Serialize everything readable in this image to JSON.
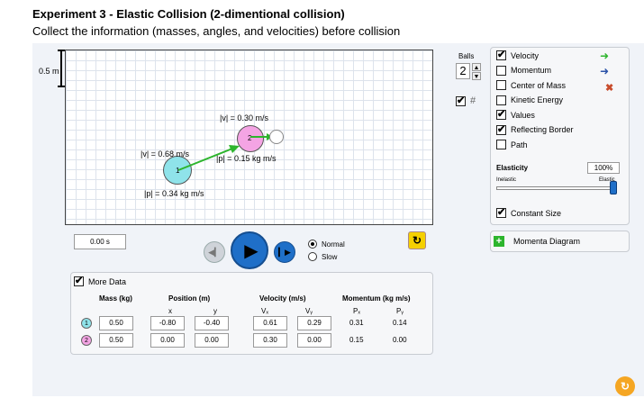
{
  "heading": "Experiment 3 - Elastic Collision (2-dimentional collision)",
  "subheading": "Collect the information (masses, angles, and velocities) before collision",
  "scale": "0.5 m",
  "field_labels": {
    "v2": "|v| = 0.30 m/s",
    "v1": "|v| = 0.68 m/s",
    "p2": "|p| = 0.15 kg m/s",
    "p1": "|p| = 0.34 kg m/s"
  },
  "ball_labels": {
    "ball1": "1",
    "ball2": "2"
  },
  "time": "0.00 s",
  "speed_options": {
    "normal": "Normal",
    "slow": "Slow"
  },
  "balls": {
    "label": "Balls",
    "count": "2"
  },
  "options": [
    {
      "label": "Velocity",
      "checked": true
    },
    {
      "label": "Momentum",
      "checked": false
    },
    {
      "label": "Center of Mass",
      "checked": false
    },
    {
      "label": "Kinetic Energy",
      "checked": false
    },
    {
      "label": "Values",
      "checked": true
    },
    {
      "label": "Reflecting Border",
      "checked": true
    },
    {
      "label": "Path",
      "checked": false
    }
  ],
  "elasticity": {
    "title": "Elasticity",
    "value": "100%",
    "min_label": "Inelastic",
    "max_label": "Elastic",
    "fraction": 1.0
  },
  "constant_size": "Constant Size",
  "momenta_diagram": "Momenta Diagram",
  "more_data": "More Data",
  "table": {
    "mass_header": "Mass (kg)",
    "position_header": "Position (m)",
    "velocity_header": "Velocity (m/s)",
    "momentum_header": "Momentum (kg m/s)",
    "sub": {
      "x": "x",
      "y": "y",
      "vx": "Vₓ",
      "vy": "Vᵧ",
      "px": "Pₓ",
      "py": "Pᵧ"
    },
    "rows": [
      {
        "id": "1",
        "mass": "0.50",
        "x": "-0.80",
        "y": "-0.40",
        "vx": "0.61",
        "vy": "0.29",
        "px": "0.31",
        "py": "0.14"
      },
      {
        "id": "2",
        "mass": "0.50",
        "x": "0.00",
        "y": "0.00",
        "vx": "0.30",
        "vy": "0.00",
        "px": "0.15",
        "py": "0.00"
      }
    ]
  },
  "colors": {
    "ball1": "#8fe3ea",
    "ball2": "#f4a4e4",
    "velocity": "#2db52d",
    "momentum": "#2a52a8",
    "com": "#c84c2c",
    "play": "#1f6fc8"
  }
}
